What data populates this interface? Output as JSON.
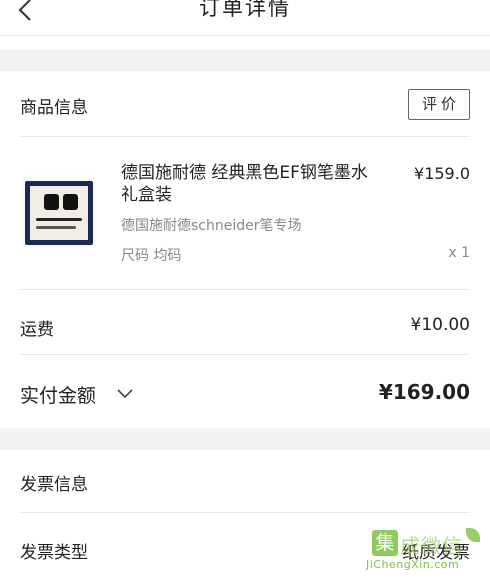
{
  "header": {
    "title": "订单详情",
    "back_icon": "chevron-left-icon"
  },
  "goods_section": {
    "title": "商品信息",
    "review_button": "评价"
  },
  "product": {
    "name": "德国施耐德 经典黑色EF钢笔墨水礼盒装",
    "price": "¥159.0",
    "shop": "德国施耐德schneider笔专场",
    "spec": "尺码  均码",
    "quantity": "x 1"
  },
  "shipping": {
    "label": "运费",
    "value": "¥10.00"
  },
  "total": {
    "label": "实付金额",
    "value": "¥169.00",
    "toggle_icon": "chevron-down-icon"
  },
  "invoice_section": {
    "title": "发票信息",
    "type_label": "发票类型",
    "type_value": "纸质发票"
  },
  "watermark": {
    "box_char": "集",
    "brand": "成微信",
    "url": "JiChengXin.com"
  },
  "colors": {
    "background": "#f2f2f2",
    "card": "#ffffff",
    "text": "#222222",
    "muted": "#888888",
    "watermark_green": "#7cc242"
  }
}
